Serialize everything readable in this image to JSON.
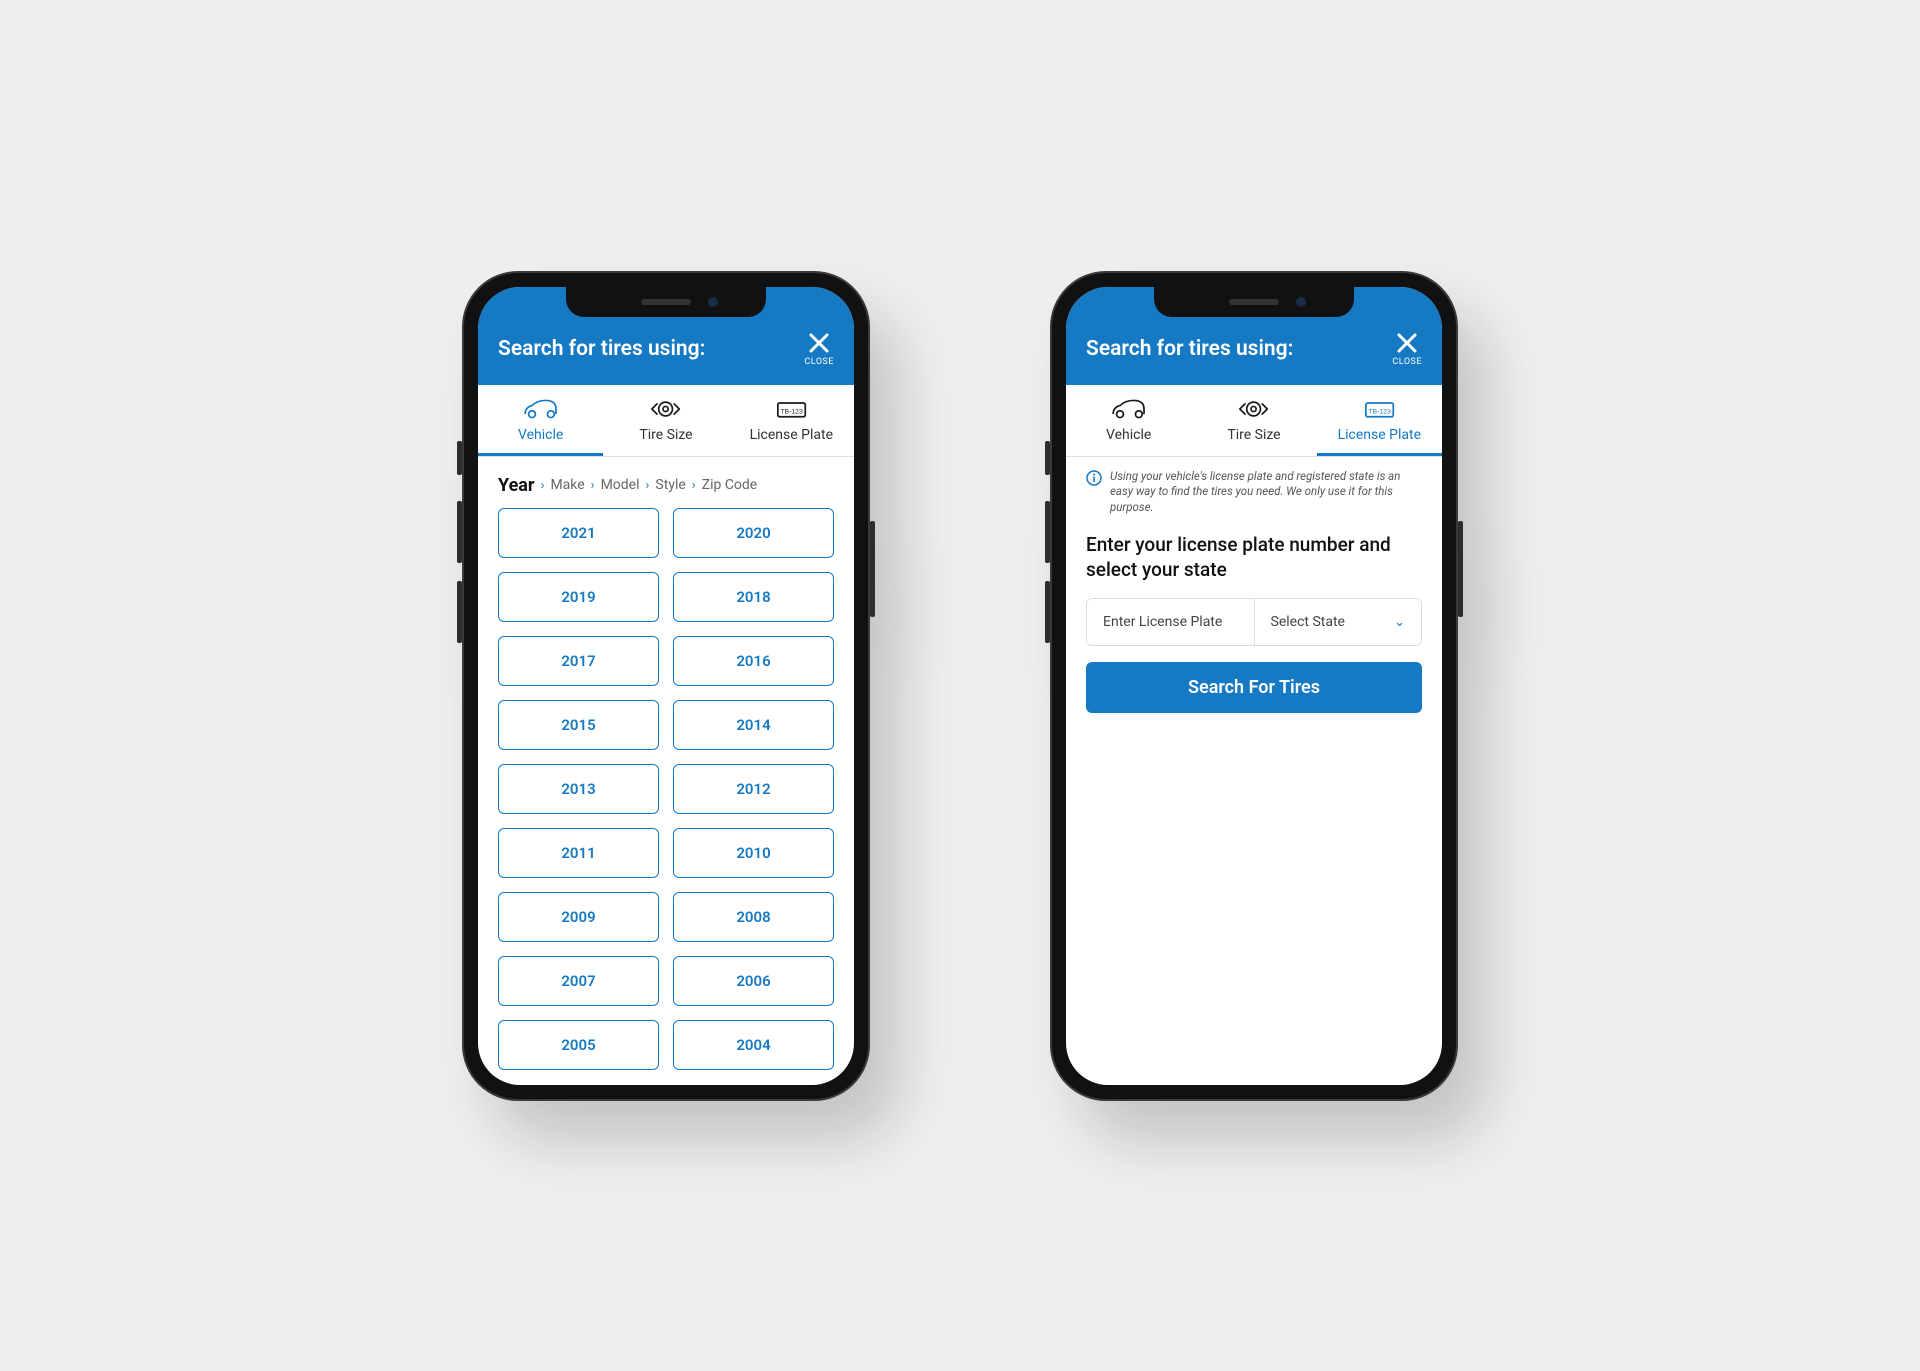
{
  "header": {
    "title": "Search for tires using:",
    "close_label": "CLOSE"
  },
  "tabs": {
    "vehicle": "Vehicle",
    "tire_size": "Tire Size",
    "license_plate": "License Plate",
    "plate_icon_text": "TB-123"
  },
  "breadcrumb_left": {
    "active": "Year",
    "items": [
      "Make",
      "Model",
      "Style",
      "Zip Code"
    ]
  },
  "years": [
    "2021",
    "2020",
    "2019",
    "2018",
    "2017",
    "2016",
    "2015",
    "2014",
    "2013",
    "2012",
    "2011",
    "2010",
    "2009",
    "2008",
    "2007",
    "2006",
    "2005",
    "2004"
  ],
  "lp": {
    "info": "Using your vehicle's license plate and registered state is an easy way to find the tires you need. We only use it for this purpose.",
    "heading": "Enter your license plate number and select your state",
    "plate_placeholder": "Enter License Plate",
    "state_placeholder": "Select State",
    "search_label": "Search For Tires"
  }
}
